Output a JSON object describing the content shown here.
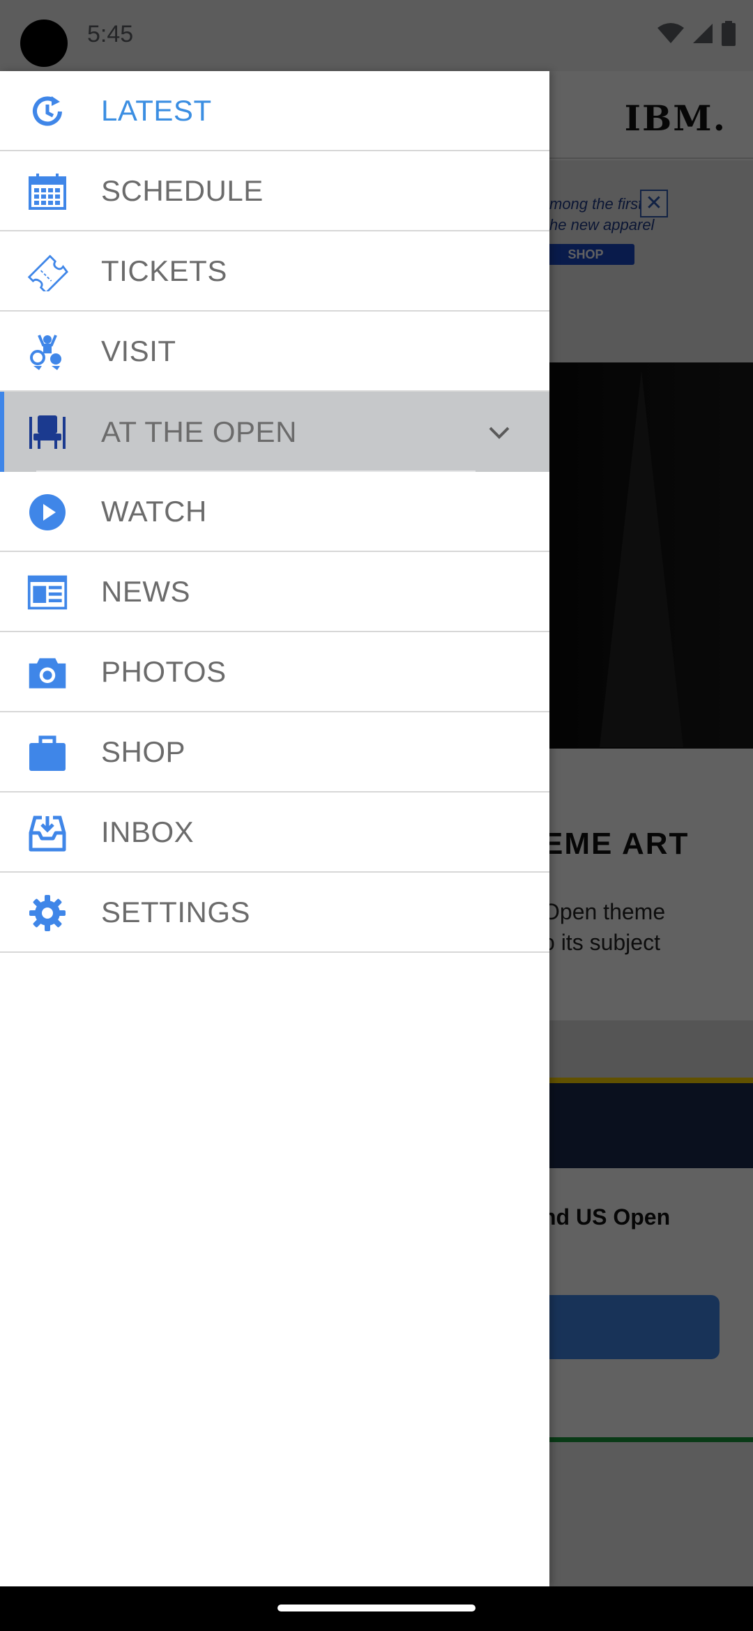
{
  "status_bar": {
    "time": "5:45"
  },
  "background_app": {
    "logo": "IBM.",
    "ad_line_1": "mong the first",
    "ad_line_2": "he new apparel",
    "ad_shop": "SHOP",
    "ad_close": "✕",
    "headline": "EME ART",
    "body_line_1": "Open theme",
    "body_line_2": "o its subject",
    "promo_text": "nd US Open"
  },
  "drawer": {
    "accent_color": "#3f86e8",
    "items": [
      {
        "label": "LATEST",
        "icon": "refresh-clock-icon",
        "active": true
      },
      {
        "label": "SCHEDULE",
        "icon": "calendar-icon"
      },
      {
        "label": "TICKETS",
        "icon": "ticket-icon"
      },
      {
        "label": "VISIT",
        "icon": "people-icon"
      },
      {
        "label": "AT THE OPEN",
        "icon": "seat-icon",
        "expanded": true
      },
      {
        "label": "WATCH",
        "icon": "play-circle-icon"
      },
      {
        "label": "NEWS",
        "icon": "newspaper-icon"
      },
      {
        "label": "PHOTOS",
        "icon": "camera-icon"
      },
      {
        "label": "SHOP",
        "icon": "shopping-bag-icon"
      },
      {
        "label": "INBOX",
        "icon": "inbox-icon"
      },
      {
        "label": "SETTINGS",
        "icon": "gear-icon"
      }
    ]
  }
}
